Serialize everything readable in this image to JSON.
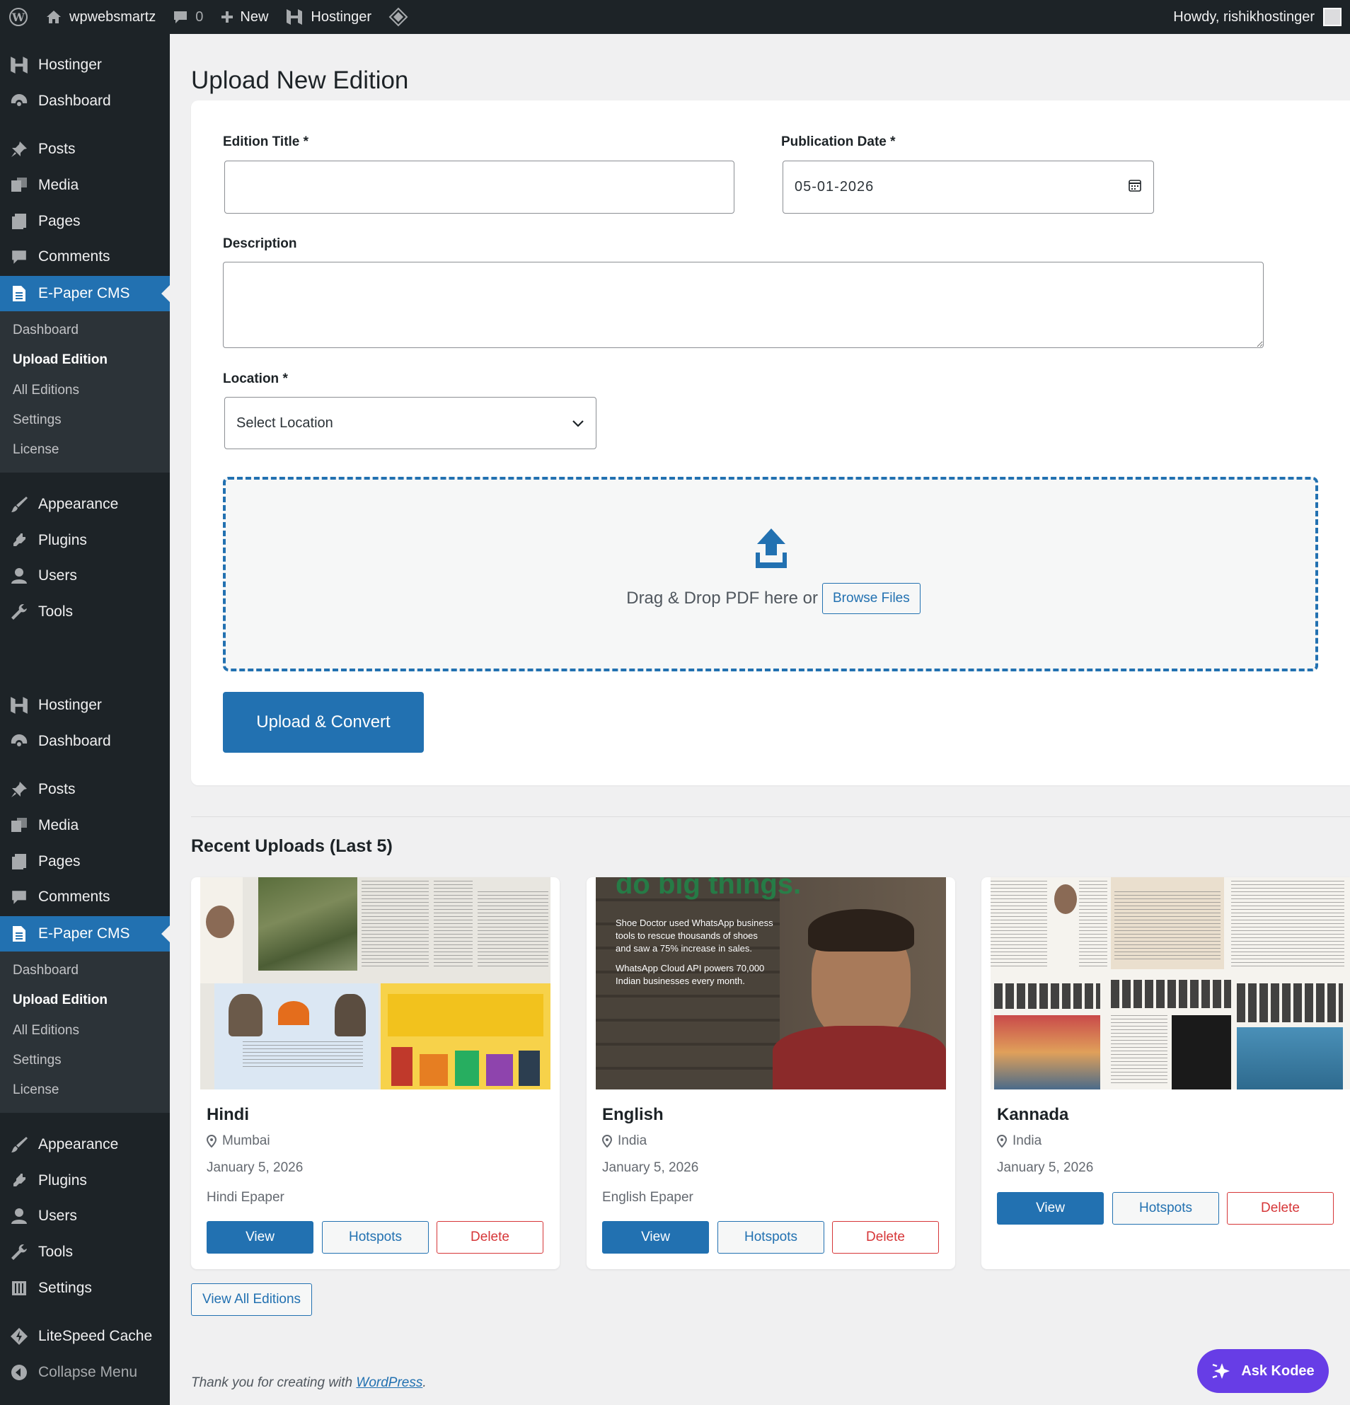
{
  "adminbar": {
    "site_name": "wpwebsmartz",
    "comments_count": "0",
    "new_label": "New",
    "hostinger_label": "Hostinger",
    "howdy": "Howdy, rishikhostinger"
  },
  "sidebar": {
    "menu1": {
      "hostinger": "Hostinger",
      "dashboard": "Dashboard",
      "posts": "Posts",
      "media": "Media",
      "pages": "Pages",
      "comments": "Comments",
      "epaper": "E-Paper CMS",
      "sub": [
        "Dashboard",
        "Upload Edition",
        "All Editions",
        "Settings",
        "License"
      ],
      "appearance": "Appearance",
      "plugins": "Plugins",
      "users": "Users",
      "tools": "Tools"
    },
    "menu2": {
      "hostinger": "Hostinger",
      "dashboard": "Dashboard",
      "posts": "Posts",
      "media": "Media",
      "pages": "Pages",
      "comments": "Comments",
      "epaper": "E-Paper CMS",
      "sub": [
        "Dashboard",
        "Upload Edition",
        "All Editions",
        "Settings",
        "License"
      ],
      "appearance": "Appearance",
      "plugins": "Plugins",
      "users": "Users",
      "tools": "Tools",
      "settings": "Settings",
      "litespeed": "LiteSpeed Cache",
      "collapse": "Collapse Menu"
    }
  },
  "page": {
    "title": "Upload New Edition",
    "form": {
      "edition_title_label": "Edition Title *",
      "edition_title_value": "",
      "publication_date_label": "Publication Date *",
      "publication_date_value": "05-01-2026",
      "description_label": "Description",
      "description_value": "",
      "location_label": "Location *",
      "location_selected": "Select Location",
      "drop_text": "Drag & Drop PDF here or",
      "browse_label": "Browse Files",
      "submit_label": "Upload & Convert"
    },
    "recent_title": "Recent Uploads (Last 5)",
    "cards": [
      {
        "name": "Hindi",
        "location": "Mumbai",
        "date": "January 5, 2026",
        "desc": "Hindi Epaper",
        "view": "View",
        "hotspots": "Hotspots",
        "delete": "Delete"
      },
      {
        "name": "English",
        "location": "India",
        "date": "January 5, 2026",
        "desc": "English Epaper",
        "view": "View",
        "hotspots": "Hotspots",
        "delete": "Delete",
        "thumb_lines": [
          "Shoe Doctor used WhatsApp business",
          "tools to rescue thousands of shoes",
          "and saw a 75% increase in sales.",
          "WhatsApp Cloud API powers 70,000",
          "Indian businesses every month."
        ],
        "thumb_headline": "do big things."
      },
      {
        "name": "Kannada",
        "location": "India",
        "date": "January 5, 2026",
        "view": "View",
        "hotspots": "Hotspots",
        "delete": "Delete"
      }
    ],
    "view_all_label": "View All Editions",
    "footer_text": "Thank you for creating with",
    "footer_link": "WordPress",
    "ask_kodee": "Ask Kodee"
  }
}
